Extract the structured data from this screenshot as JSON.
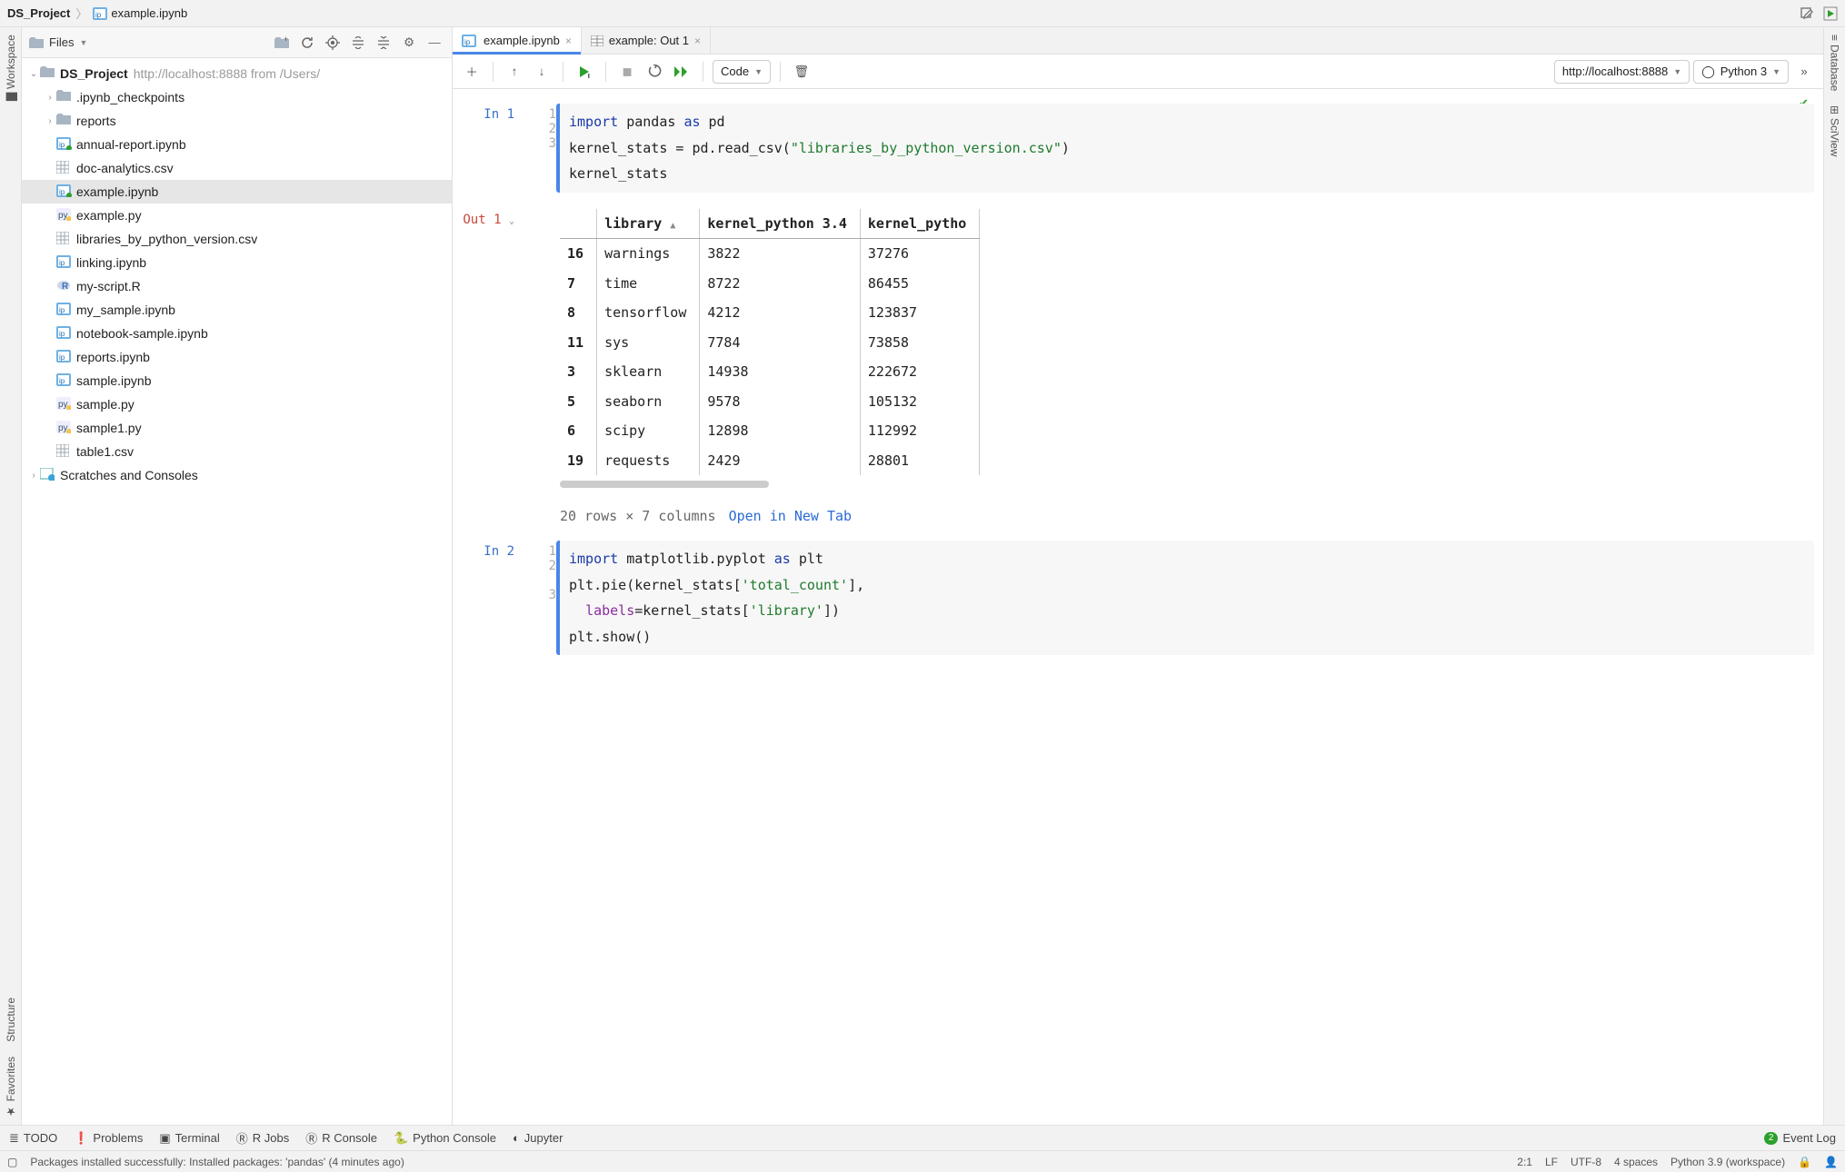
{
  "breadcrumb": {
    "project": "DS_Project",
    "file": "example.ipynb"
  },
  "topbar": {
    "edit_icon": "edit",
    "run_target_icon": "run-target"
  },
  "left_tabs": [
    "Workspace",
    "Structure",
    "Favorites"
  ],
  "right_tabs": [
    "Database",
    "SciView"
  ],
  "sidebar": {
    "selector_label": "Files",
    "root": {
      "name": "DS_Project",
      "hint": "http://localhost:8888 from /Users/"
    },
    "tree": [
      {
        "name": ".ipynb_checkpoints",
        "icon": "folder",
        "depth": 1,
        "arrow": ">"
      },
      {
        "name": "reports",
        "icon": "folder",
        "depth": 1,
        "arrow": ">"
      },
      {
        "name": "annual-report.ipynb",
        "icon": "nb-run",
        "depth": 1
      },
      {
        "name": "doc-analytics.csv",
        "icon": "csv",
        "depth": 1
      },
      {
        "name": "example.ipynb",
        "icon": "nb-run",
        "depth": 1,
        "selected": true
      },
      {
        "name": "example.py",
        "icon": "py",
        "depth": 1
      },
      {
        "name": "libraries_by_python_version.csv",
        "icon": "csv",
        "depth": 1
      },
      {
        "name": "linking.ipynb",
        "icon": "nb",
        "depth": 1
      },
      {
        "name": "my-script.R",
        "icon": "r",
        "depth": 1
      },
      {
        "name": "my_sample.ipynb",
        "icon": "nb",
        "depth": 1
      },
      {
        "name": "notebook-sample.ipynb",
        "icon": "nb",
        "depth": 1
      },
      {
        "name": "reports.ipynb",
        "icon": "nb",
        "depth": 1
      },
      {
        "name": "sample.ipynb",
        "icon": "nb",
        "depth": 1
      },
      {
        "name": "sample.py",
        "icon": "py",
        "depth": 1
      },
      {
        "name": "sample1.py",
        "icon": "py",
        "depth": 1
      },
      {
        "name": "table1.csv",
        "icon": "csv",
        "depth": 1
      }
    ],
    "scratches": "Scratches and Consoles"
  },
  "editor_tabs": [
    {
      "label": "example.ipynb",
      "icon": "nb",
      "active": true
    },
    {
      "label": "example: Out 1",
      "icon": "table",
      "active": false
    }
  ],
  "nb_toolbar": {
    "cell_type": "Code",
    "server": "http://localhost:8888",
    "kernel": "Python 3"
  },
  "cells": {
    "in1": {
      "prompt": "In 1",
      "lines": [
        "1",
        "2",
        "3"
      ],
      "code_html": [
        "<span class='kw'>import</span> pandas <span class='kw'>as</span> pd",
        "kernel_stats = pd.read_csv(<span class='str'>\"libraries_by_python_version.csv\"</span>)",
        "kernel_stats"
      ]
    },
    "out1": {
      "prompt": "Out 1",
      "columns": [
        "",
        "library",
        "kernel_python 3.4",
        "kernel_pytho"
      ],
      "rows": [
        [
          "16",
          "warnings",
          "3822",
          "37276"
        ],
        [
          "7",
          "time",
          "8722",
          "86455"
        ],
        [
          "8",
          "tensorflow",
          "4212",
          "123837"
        ],
        [
          "11",
          "sys",
          "7784",
          "73858"
        ],
        [
          "3",
          "sklearn",
          "14938",
          "222672"
        ],
        [
          "5",
          "seaborn",
          "9578",
          "105132"
        ],
        [
          "6",
          "scipy",
          "12898",
          "112992"
        ],
        [
          "19",
          "requests",
          "2429",
          "28801"
        ]
      ],
      "meta": "20 rows × 7 columns",
      "open_link": "Open in New Tab"
    },
    "in2": {
      "prompt": "In 2",
      "lines": [
        "1",
        "2",
        "",
        "3"
      ],
      "code_html": [
        "<span class='kw'>import</span> matplotlib.pyplot <span class='kw'>as</span> plt",
        "plt.pie(kernel_stats[<span class='str'>'total_count'</span>],",
        "  <span class='var'>labels</span>=kernel_stats[<span class='str'>'library'</span>])",
        "plt.show()"
      ]
    }
  },
  "bottom_tabs": [
    "TODO",
    "Problems",
    "Terminal",
    "R Jobs",
    "R Console",
    "Python Console",
    "Jupyter"
  ],
  "event_log": {
    "count": "2",
    "label": "Event Log"
  },
  "status": {
    "message": "Packages installed successfully: Installed packages: 'pandas' (4 minutes ago)",
    "caret": "2:1",
    "linesep": "LF",
    "encoding": "UTF-8",
    "indent": "4 spaces",
    "interpreter": "Python 3.9 (workspace)"
  }
}
